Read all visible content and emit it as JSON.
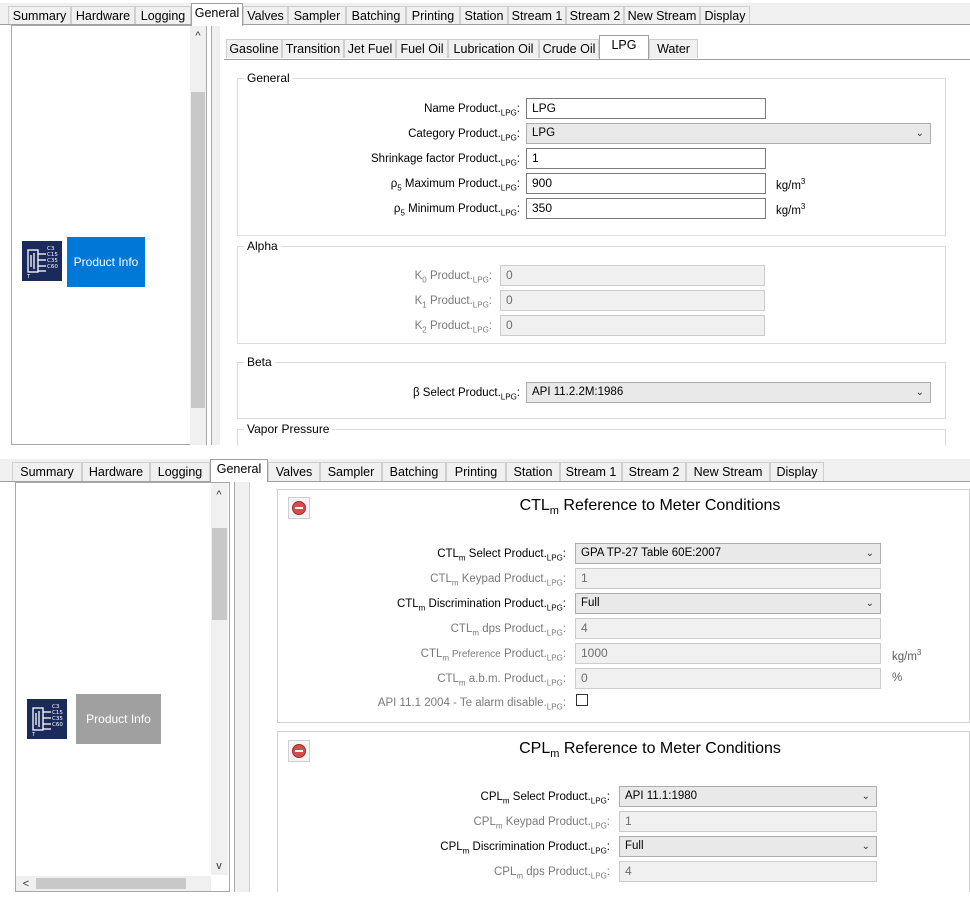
{
  "main_tabs": [
    "Summary",
    "Hardware",
    "Logging",
    "General",
    "Valves",
    "Sampler",
    "Batching",
    "Printing",
    "Station",
    "Stream 1",
    "Stream 2",
    "New Stream",
    "Display"
  ],
  "sidebar": {
    "product_info_label": "Product Info",
    "scroll_up": "^",
    "scroll_down": "v",
    "scroll_left": "<",
    "scroll_right": ">"
  },
  "product_tabs": [
    "Gasoline",
    "Transition",
    "Jet Fuel",
    "Fuel Oil",
    "Lubrication Oil",
    "Crude Oil",
    "LPG",
    "Water"
  ],
  "suffix": "LPG",
  "general": {
    "legend": "General",
    "name_label": "Name Product.",
    "name_value": "LPG",
    "category_label": "Category Product.",
    "category_value": "LPG",
    "shrinkage_label": "Shrinkage factor Product.",
    "shrinkage_value": "1",
    "max_label_pre": "ρ",
    "max_label_sub": "5",
    "max_label": " Maximum Product.",
    "max_value": "900",
    "min_label_pre": "ρ",
    "min_label_sub": "5",
    "min_label": " Minimum Product.",
    "min_value": "350",
    "unit_kgm": "kg/m",
    "unit_kgm_sup": "3"
  },
  "alpha": {
    "legend": "Alpha",
    "k0_pre": "K",
    "k0_sub": "0",
    "k0_value": "0",
    "k1_pre": "K",
    "k1_sub": "1",
    "k1_value": "0",
    "k2_pre": "K",
    "k2_sub": "2",
    "k2_value": "0",
    "label_rest": " Product."
  },
  "beta": {
    "legend": "Beta",
    "label": "β Select Product.",
    "value": "API 11.2.2M:1986"
  },
  "vapor": {
    "legend": "Vapor Pressure"
  },
  "ctl": {
    "title_pre": "CTL",
    "title_sub": "m",
    "title_rest": " Reference to Meter Conditions",
    "pre": "CTL",
    "sub": "m",
    "select_label": " Select Product.",
    "select_value": "GPA TP-27 Table 60E:2007",
    "keypad_label": " Keypad Product.",
    "keypad_value": "1",
    "disc_label": " Discrimination Product.",
    "disc_value": "Full",
    "dps_label": " dps Product.",
    "dps_value": "4",
    "pref_mid": " Preference",
    "pref_label": " Product.",
    "pref_value": "1000",
    "abm_label": " a.b.m. Product.",
    "abm_value": "0",
    "api_label": "API 11.1 2004 - Te alarm disable.",
    "unit_kgm": "kg/m",
    "unit_kgm_sup": "3",
    "unit_pct": "%"
  },
  "cpl": {
    "title_pre": "CPL",
    "title_sub": "m",
    "title_rest": " Reference to Meter Conditions",
    "pre": "CPL",
    "sub": "m",
    "select_label": " Select Product.",
    "select_value": "API 11.1:1980",
    "keypad_label": " Keypad Product.",
    "keypad_value": "1",
    "disc_label": " Discrimination Product.",
    "disc_value": "Full",
    "dps_label": " dps Product.",
    "dps_value": "4"
  },
  "colors": {
    "product_info_active": "#0078d7",
    "product_info_inactive": "#a0a0a0",
    "collapse_icon": "#d84b4b"
  }
}
